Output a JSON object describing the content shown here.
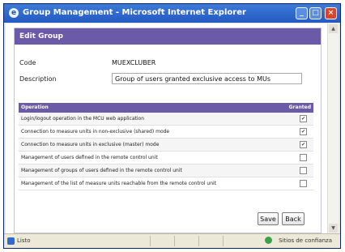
{
  "window": {
    "title": "Group Management - Microsoft Internet Explorer",
    "min_glyph": "_",
    "max_glyph": "□",
    "close_glyph": "×"
  },
  "panel": {
    "header": "Edit Group",
    "code_label": "Code",
    "code_value": "MUEXCLUBER",
    "desc_label": "Description",
    "desc_value": "Group of users granted exclusive access to MUs"
  },
  "table": {
    "col_operation": "Operation",
    "col_granted": "Granted",
    "rows": [
      {
        "operation": "Login/logout operation in the MCU web application",
        "granted": true
      },
      {
        "operation": "Connection to measure units in non-exclusive (shared) mode",
        "granted": true
      },
      {
        "operation": "Connection to measure units in exclusive (master) mode",
        "granted": true
      },
      {
        "operation": "Management of users defined in the remote control unit",
        "granted": false
      },
      {
        "operation": "Management of groups of users defined in the remote control unit",
        "granted": false
      },
      {
        "operation": "Management of the list of measure units reachable from the remote control unit",
        "granted": false
      }
    ]
  },
  "buttons": {
    "save": "Save",
    "back": "Back"
  },
  "statusbar": {
    "left": "Listo",
    "right": "Sitios de confianza"
  },
  "icons": {
    "checked": "✔",
    "unchecked": ""
  }
}
